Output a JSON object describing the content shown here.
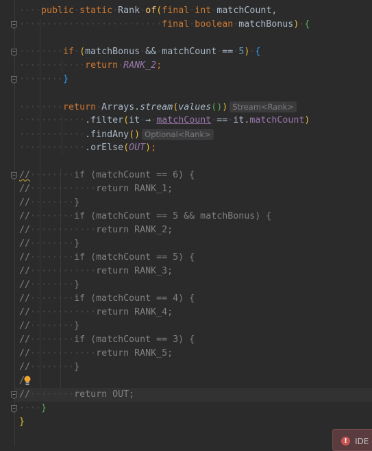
{
  "editor": {
    "current_line": 28,
    "lines": [
      [
        [
          "    ",
          "ws"
        ],
        [
          "public",
          "kw"
        ],
        [
          " ",
          "ws"
        ],
        [
          "static",
          "kw"
        ],
        [
          " ",
          "ws"
        ],
        [
          "Rank",
          "id"
        ],
        [
          " ",
          "ws"
        ],
        [
          "of",
          "method"
        ],
        [
          "(",
          "p1"
        ],
        [
          "final",
          "kw"
        ],
        [
          " ",
          "ws"
        ],
        [
          "int",
          "kw"
        ],
        [
          " ",
          "ws"
        ],
        [
          "matchCount,",
          "id"
        ]
      ],
      [
        [
          "                          ",
          "ws"
        ],
        [
          "final",
          "kw"
        ],
        [
          " ",
          "ws"
        ],
        [
          "boolean",
          "kw"
        ],
        [
          " ",
          "ws"
        ],
        [
          "matchBonus",
          "id"
        ],
        [
          ")",
          "p1"
        ],
        [
          " ",
          "ws"
        ],
        [
          "{",
          "p2"
        ]
      ],
      [],
      [
        [
          "        ",
          "ws"
        ],
        [
          "if",
          "kw"
        ],
        [
          " ",
          "ws"
        ],
        [
          "(",
          "p1"
        ],
        [
          "matchBonus",
          "id"
        ],
        [
          " ",
          "ws"
        ],
        [
          "&&",
          "id"
        ],
        [
          " ",
          "ws"
        ],
        [
          "matchCount",
          "id"
        ],
        [
          " ",
          "ws"
        ],
        [
          "==",
          "id"
        ],
        [
          " ",
          "ws"
        ],
        [
          "5",
          "num"
        ],
        [
          ")",
          "p1"
        ],
        [
          " ",
          "ws"
        ],
        [
          "{",
          "p3"
        ]
      ],
      [
        [
          "            ",
          "ws"
        ],
        [
          "return",
          "kw"
        ],
        [
          " ",
          "ws"
        ],
        [
          "RANK_2",
          "const"
        ],
        [
          ";",
          "kw"
        ]
      ],
      [
        [
          "        ",
          "ws"
        ],
        [
          "}",
          "p3"
        ]
      ],
      [],
      [
        [
          "        ",
          "ws"
        ],
        [
          "return",
          "kw"
        ],
        [
          " ",
          "ws"
        ],
        [
          "Arrays.",
          "id"
        ],
        [
          "stream",
          "smethod"
        ],
        [
          "(",
          "p1"
        ],
        [
          "values",
          "smethod"
        ],
        [
          "()",
          "p2"
        ],
        [
          ")",
          "p1"
        ],
        [
          "Stream<Rank>",
          "hint"
        ]
      ],
      [
        [
          "            ",
          "ws"
        ],
        [
          ".filter",
          "id"
        ],
        [
          "(",
          "p1"
        ],
        [
          "it",
          "id"
        ],
        [
          " ",
          "ws"
        ],
        [
          "→",
          "id"
        ],
        [
          " ",
          "ws"
        ],
        [
          "matchCount",
          "fieldu"
        ],
        [
          " ",
          "ws"
        ],
        [
          "==",
          "id"
        ],
        [
          " ",
          "ws"
        ],
        [
          "it.",
          "id"
        ],
        [
          "matchCount",
          "field"
        ],
        [
          ")",
          "p1"
        ]
      ],
      [
        [
          "            ",
          "ws"
        ],
        [
          ".findAny",
          "id"
        ],
        [
          "()",
          "p1"
        ],
        [
          "Optional<Rank>",
          "hint"
        ]
      ],
      [
        [
          "            ",
          "ws"
        ],
        [
          ".orElse",
          "id"
        ],
        [
          "(",
          "p1"
        ],
        [
          "OUT",
          "const"
        ],
        [
          ")",
          "p1"
        ],
        [
          ";",
          "kw"
        ]
      ],
      [],
      [
        [
          "//",
          "cmslash"
        ],
        [
          "        ",
          "ws"
        ],
        [
          "if (matchCount == 6) {",
          "cm"
        ]
      ],
      [
        [
          "//",
          "cm"
        ],
        [
          "            ",
          "ws"
        ],
        [
          "return RANK_1;",
          "cm"
        ]
      ],
      [
        [
          "//",
          "cm"
        ],
        [
          "        ",
          "ws"
        ],
        [
          "}",
          "cm"
        ]
      ],
      [
        [
          "//",
          "cm"
        ],
        [
          "        ",
          "ws"
        ],
        [
          "if (matchCount == 5 && matchBonus) {",
          "cm"
        ]
      ],
      [
        [
          "//",
          "cm"
        ],
        [
          "            ",
          "ws"
        ],
        [
          "return RANK_2;",
          "cm"
        ]
      ],
      [
        [
          "//",
          "cm"
        ],
        [
          "        ",
          "ws"
        ],
        [
          "}",
          "cm"
        ]
      ],
      [
        [
          "//",
          "cm"
        ],
        [
          "        ",
          "ws"
        ],
        [
          "if (matchCount == 5) {",
          "cm"
        ]
      ],
      [
        [
          "//",
          "cm"
        ],
        [
          "            ",
          "ws"
        ],
        [
          "return RANK_3;",
          "cm"
        ]
      ],
      [
        [
          "//",
          "cm"
        ],
        [
          "        ",
          "ws"
        ],
        [
          "}",
          "cm"
        ]
      ],
      [
        [
          "//",
          "cm"
        ],
        [
          "        ",
          "ws"
        ],
        [
          "if (matchCount == 4) {",
          "cm"
        ]
      ],
      [
        [
          "//",
          "cm"
        ],
        [
          "            ",
          "ws"
        ],
        [
          "return RANK_4;",
          "cm"
        ]
      ],
      [
        [
          "//",
          "cm"
        ],
        [
          "        ",
          "ws"
        ],
        [
          "}",
          "cm"
        ]
      ],
      [
        [
          "//",
          "cm"
        ],
        [
          "        ",
          "ws"
        ],
        [
          "if (matchCount == 3) {",
          "cm"
        ]
      ],
      [
        [
          "//",
          "cm"
        ],
        [
          "            ",
          "ws"
        ],
        [
          "return RANK_5;",
          "cm"
        ]
      ],
      [
        [
          "//",
          "cm"
        ],
        [
          "        ",
          "ws"
        ],
        [
          "}",
          "cm"
        ]
      ],
      [
        [
          "/",
          "cm"
        ]
      ],
      [
        [
          "//",
          "cm"
        ],
        [
          "        ",
          "ws"
        ],
        [
          "return OUT;",
          "cm"
        ]
      ],
      [
        [
          "    ",
          "ws"
        ],
        [
          "}",
          "p2"
        ]
      ],
      [
        [
          "}",
          "p1"
        ]
      ]
    ],
    "fold_lines": [
      1,
      3,
      5,
      12,
      28,
      29
    ]
  },
  "icons": {
    "intention": "lightbulb-icon",
    "fold": "fold-marker-icon",
    "error": "error-icon"
  },
  "notification": {
    "text": "IDE e",
    "icon_glyph": "!"
  },
  "colors": {
    "keyword": "#cc7832",
    "constant": "#9876aa",
    "method": "#ffc66d",
    "comment": "#808080",
    "number": "#6897bb",
    "error": "#c75450"
  }
}
